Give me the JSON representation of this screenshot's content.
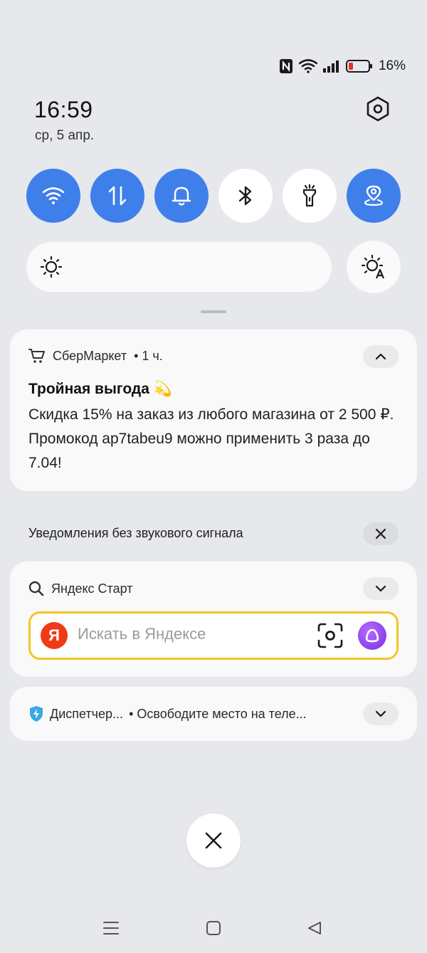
{
  "status_bar": {
    "battery_percent": "16%",
    "icons": [
      "nfc-icon",
      "wifi-icon",
      "signal-icon",
      "battery-icon"
    ]
  },
  "header": {
    "time": "16:59",
    "date": "ср, 5 апр."
  },
  "quick_toggles": [
    {
      "name": "wifi",
      "icon": "wifi-icon",
      "state": "on"
    },
    {
      "name": "mobile-data",
      "icon": "data-arrows-icon",
      "state": "on"
    },
    {
      "name": "sound",
      "icon": "bell-icon",
      "state": "on"
    },
    {
      "name": "bluetooth",
      "icon": "bluetooth-icon",
      "state": "off"
    },
    {
      "name": "flashlight",
      "icon": "flashlight-icon",
      "state": "off"
    },
    {
      "name": "location",
      "icon": "location-icon",
      "state": "on"
    }
  ],
  "brightness": {
    "icon": "sun-icon",
    "auto_icon": "auto-brightness-icon"
  },
  "notification_sbermarket": {
    "app_name": "СберМаркет",
    "time": "• 1 ч.",
    "title": "Тройная выгода 💫",
    "body": "Скидка 15% на заказ из любого магазина от 2 500 ₽. Промокод ap7tabeu9 можно применить 3 раза до 7.04!"
  },
  "silent_section": {
    "label": "Уведомления без звукового сигнала"
  },
  "notification_yandex": {
    "app_name": "Яндекс Старт",
    "logo_letter": "Я",
    "search_placeholder": "Искать в Яндексе"
  },
  "notification_dispatcher": {
    "app_name": "Диспетчер...",
    "text": "• Освободите место на теле..."
  },
  "colors": {
    "accent": "#3f7fea",
    "search_border": "#f3c623",
    "yandex_red": "#f03a17",
    "alice_purple": "#8a3cf0"
  }
}
